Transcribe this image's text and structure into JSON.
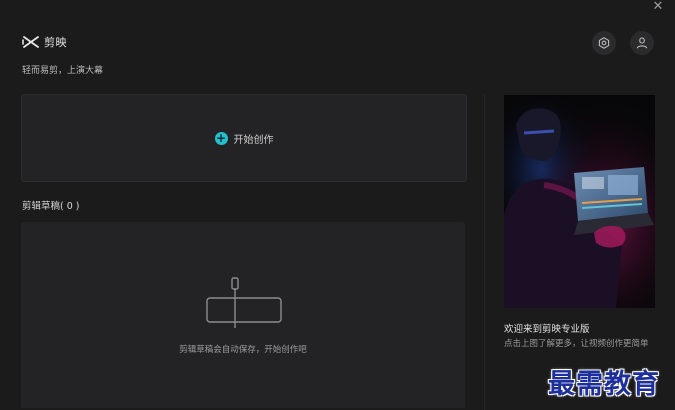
{
  "window": {
    "close_symbol": "✕"
  },
  "brand": {
    "name": "剪映",
    "logo_icon": "capcut-logo-icon"
  },
  "tagline": "轻而易剪，上演大幕",
  "header_actions": {
    "settings_icon": "settings-hexagon-icon",
    "user_icon": "user-icon"
  },
  "create": {
    "label": "开始创作",
    "icon": "plus-circle-icon",
    "accent": "#21c1d0"
  },
  "drafts": {
    "title": "剪辑草稿( 0 )",
    "empty_text": "剪辑草稿会自动保存，开始创作吧"
  },
  "promo": {
    "title": "欢迎来到剪映专业版",
    "description": "点击上图了解更多，让视频创作更简单"
  },
  "watermark": {
    "text": "最需教育",
    "color": "#1d2f9a"
  }
}
